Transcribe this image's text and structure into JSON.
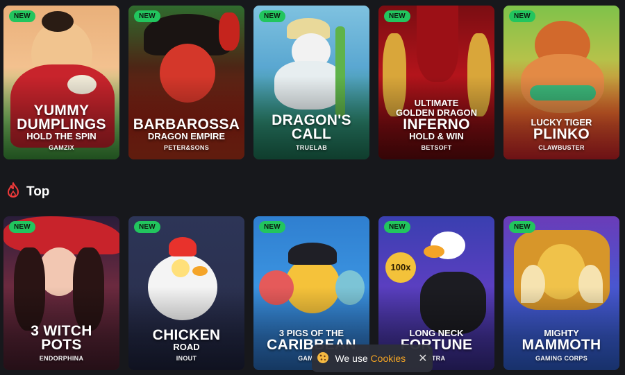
{
  "badge_label": "NEW",
  "row1": [
    {
      "line1": "",
      "big": [
        "YUMMY",
        "DUMPLINGS"
      ],
      "mid": [
        "HOLD THE SPIN"
      ],
      "provider": "GAMZIX"
    },
    {
      "line1": "",
      "big": [
        "BARBAROSSA"
      ],
      "mid": [
        "DRAGON EMPIRE"
      ],
      "provider": "PETER&SONS"
    },
    {
      "line1": "",
      "big": [
        "DRAGON'S",
        "CALL"
      ],
      "mid": [],
      "provider": "TRUELAB"
    },
    {
      "line1": "",
      "big": [
        "INFERNO"
      ],
      "mid_top": [
        "ULTIMATE",
        "GOLDEN DRAGON"
      ],
      "mid": [
        "HOLD & WIN"
      ],
      "provider": "BETSOFT"
    },
    {
      "line1": "",
      "big": [
        "PLINKO"
      ],
      "mid_top": [
        "LUCKY TIGER"
      ],
      "mid": [],
      "provider": "CLAWBUSTER"
    }
  ],
  "section": {
    "title": "Top",
    "icon": "flame-icon"
  },
  "row2": [
    {
      "big": [
        "3 WITCH",
        "POTS"
      ],
      "mid": [],
      "provider": "ENDORPHINA"
    },
    {
      "big": [
        "CHICKEN"
      ],
      "mid": [
        "ROAD"
      ],
      "provider": "INOUT"
    },
    {
      "big": [
        "CARIBBEAN"
      ],
      "mid_top": [
        "3 PIGS OF THE"
      ],
      "mid": [],
      "provider": "GAMING"
    },
    {
      "big": [
        "FORTUNE"
      ],
      "mid_top": [
        "LONG NECK"
      ],
      "mid": [],
      "provider": "ATRA"
    },
    {
      "big": [
        "MAMMOTH"
      ],
      "mid_top": [
        "MIGHTY"
      ],
      "mid": [],
      "provider": "GAMING CORPS"
    }
  ],
  "cookie": {
    "prefix": "We use",
    "accent": "Cookies",
    "icon": "cookie-icon",
    "close": "✕"
  },
  "chips": {
    "coin": "100x"
  }
}
